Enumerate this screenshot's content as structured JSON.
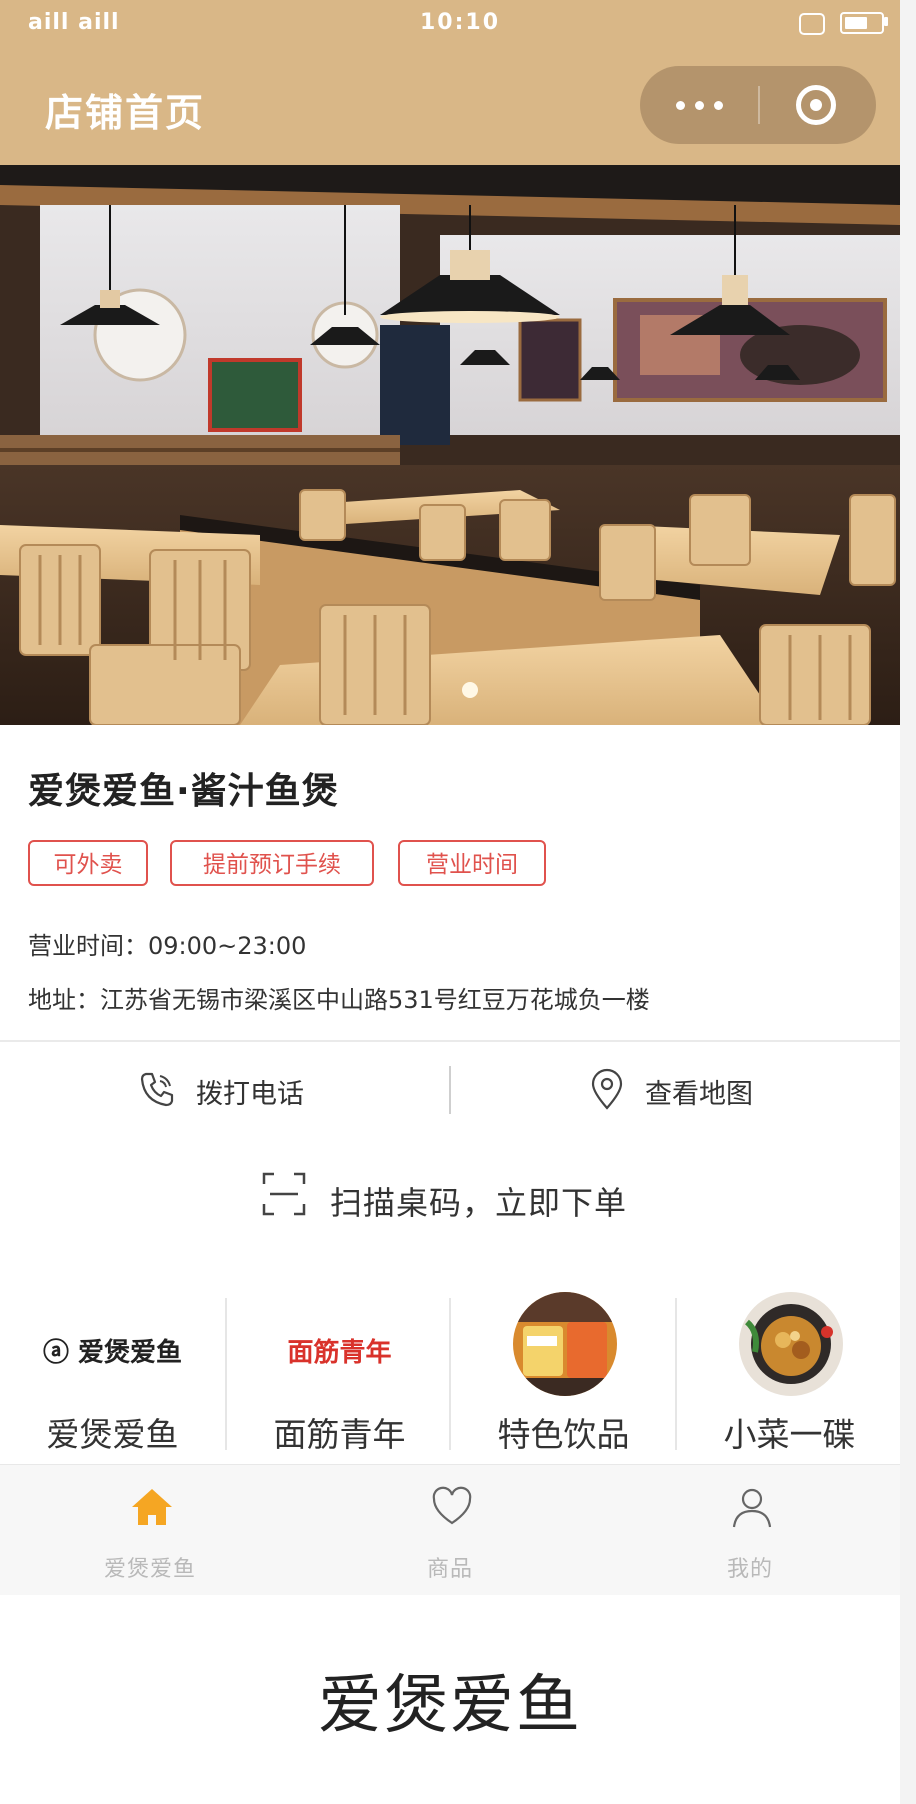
{
  "status_bar": {
    "carrier": "aill aill",
    "time": "10:10"
  },
  "header": {
    "title": "店铺首页"
  },
  "store": {
    "name": "爱煲爱鱼·酱汁鱼煲",
    "tags": [
      "可外卖",
      "提前预订手续",
      "营业时间"
    ],
    "hours": "营业时间：09:00~23:00",
    "address": "地址：江苏省无锡市梁溪区中山路531号红豆万花城负一楼"
  },
  "actions": {
    "call": "拨打电话",
    "navigate": "查看地图"
  },
  "scan": {
    "label": "扫描桌码，立即下单"
  },
  "categories": [
    {
      "label": "爱煲爱鱼",
      "logo_text": "ⓐ 爱煲爱鱼"
    },
    {
      "label": "面筋青年",
      "logo_text": "面筋青年"
    },
    {
      "label": "特色饮品"
    },
    {
      "label": "小菜一碟"
    }
  ],
  "tabbar": [
    {
      "label": "爱煲爱鱼",
      "icon": "home-icon",
      "active": true
    },
    {
      "label": "商品",
      "icon": "heart-icon",
      "active": false
    },
    {
      "label": "我的",
      "icon": "user-icon",
      "active": false
    }
  ],
  "footer": {
    "brand": "爱煲爱鱼"
  },
  "colors": {
    "header": "#d9b787",
    "tag_red": "#e0524d",
    "tab_active": "#f5a623"
  }
}
